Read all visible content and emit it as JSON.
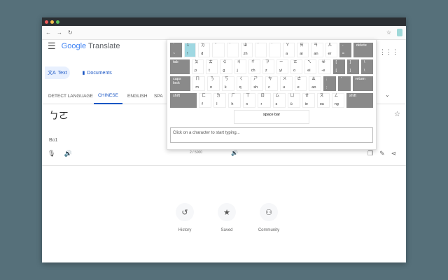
{
  "colors": {
    "accent": "#1a56c4",
    "bg": "#56707a"
  },
  "header": {
    "logo_google": "Google",
    "logo_translate": "Translate"
  },
  "modes": [
    {
      "label": "Text",
      "icon": "translate-icon"
    },
    {
      "label": "Documents",
      "icon": "document-icon"
    }
  ],
  "languages": [
    "DETECT LANGUAGE",
    "CHINESE",
    "ENGLISH",
    "SPA"
  ],
  "source": {
    "text": "ㄅㄛ",
    "romanization": "Bo1",
    "counter": "2 / 5000"
  },
  "bottom": [
    {
      "label": "History",
      "icon": "↺"
    },
    {
      "label": "Saved",
      "icon": "★"
    },
    {
      "label": "Community",
      "icon": "⚇"
    }
  ],
  "keyboard": {
    "rows": [
      [
        [
          "`",
          "~",
          "g"
        ],
        [
          "1",
          "!",
          "c"
        ],
        [
          "ㄉ",
          "d"
        ],
        [
          "ˇ",
          ""
        ],
        [
          "ˋ",
          ""
        ],
        [
          "ㄓ",
          "zh"
        ],
        [
          "ˊ",
          ""
        ],
        [
          "˙",
          ""
        ],
        [
          "ㄚ",
          "a"
        ],
        [
          "ㄞ",
          "ai"
        ],
        [
          "ㄢ",
          "an"
        ],
        [
          "ㄦ",
          "er"
        ],
        [
          "-",
          "=",
          "g"
        ],
        [
          "delete",
          "",
          "g w2"
        ]
      ],
      [
        [
          "tab",
          "",
          "g w2"
        ],
        [
          "ㄆ",
          "p"
        ],
        [
          "ㄊ",
          "t"
        ],
        [
          "ㄍ",
          "g"
        ],
        [
          "ㄐ",
          "j"
        ],
        [
          "ㄔ",
          "ch"
        ],
        [
          "ㄗ",
          "z"
        ],
        [
          "ㄧ",
          "yi"
        ],
        [
          "ㄛ",
          "o"
        ],
        [
          "ㄟ",
          "ei"
        ],
        [
          "ㄝ",
          "-e"
        ],
        [
          "[",
          "[",
          "g"
        ],
        [
          "]",
          "]",
          "g"
        ],
        [
          "\\",
          "\\",
          "g"
        ]
      ],
      [
        [
          "caps lock",
          "",
          "g w2"
        ],
        [
          "ㄇ",
          "m"
        ],
        [
          "ㄋ",
          "n"
        ],
        [
          "ㄎ",
          "k"
        ],
        [
          "ㄑ",
          "q"
        ],
        [
          "ㄕ",
          "sh"
        ],
        [
          "ㄘ",
          "c"
        ],
        [
          "ㄨ",
          "u"
        ],
        [
          "ㄜ",
          "e"
        ],
        [
          "ㄠ",
          "ao"
        ],
        [
          ";",
          ";",
          "g"
        ],
        [
          "'",
          "",
          "g"
        ],
        [
          "return",
          "",
          "g w2"
        ]
      ],
      [
        [
          "shift",
          "",
          "g w3"
        ],
        [
          "ㄈ",
          "f"
        ],
        [
          "ㄌ",
          "l"
        ],
        [
          "ㄏ",
          "h"
        ],
        [
          "ㄒ",
          "x"
        ],
        [
          "ㄖ",
          "r"
        ],
        [
          "ㄙ",
          "s"
        ],
        [
          "ㄩ",
          "ü"
        ],
        [
          "ㄝ",
          "ie"
        ],
        [
          "ㄡ",
          "ou"
        ],
        [
          "ㄥ",
          "ng"
        ],
        [
          "shift",
          "",
          "g w3"
        ]
      ]
    ],
    "space_label": "space bar",
    "input_placeholder": "Click on a character to start typing..."
  }
}
